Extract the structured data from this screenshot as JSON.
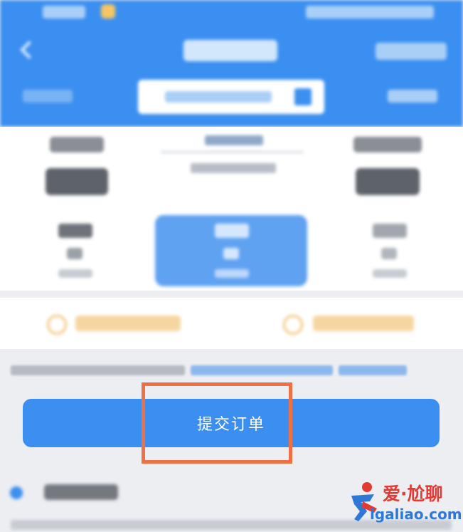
{
  "submit_button": {
    "label": "提交订单"
  },
  "watermark": {
    "line1": "爱·尬聊",
    "line2": "igaliao.com"
  },
  "colors": {
    "header_bg": "#3b8ff0",
    "page_bg": "#eceef2",
    "accent_orange": "#ee7045",
    "selected_seat": "#5fa2f1",
    "people_icon": "#f5c57a"
  },
  "icons": [
    "back-arrow-icon",
    "calendar-icon",
    "train-icon",
    "add-person-icon",
    "tip-bullet-icon",
    "watermark-logo-icon"
  ]
}
